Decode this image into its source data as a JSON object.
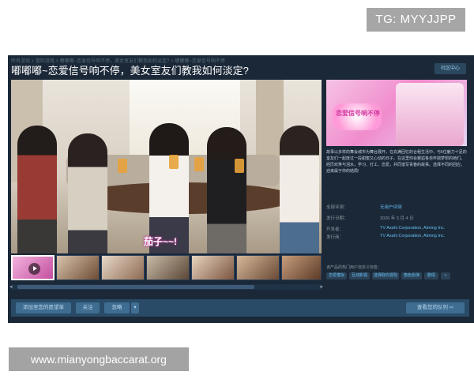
{
  "overlay": {
    "tg_badge": "TG: MYYJJPP",
    "website_watermark": "www.mianyongbaccarat.org"
  },
  "store_page": {
    "breadcrumb": "所有游戏 > 冒险游戏 > 嘟嘟嘟~恋爱信号响不停，美女室友们教我如何淡定? > 嘟嘟嘟~恋爱信号响不停",
    "title": "嘟嘟嘟~恋爱信号响不停，美女室友们教我如何淡定?",
    "community_button": "社区中心",
    "media": {
      "main_caption": "茄子~~!",
      "thumbnails": [
        {
          "type": "video",
          "active": true
        },
        {
          "type": "screenshot",
          "active": false
        },
        {
          "type": "screenshot",
          "active": false
        },
        {
          "type": "screenshot",
          "active": false
        },
        {
          "type": "screenshot",
          "active": false
        },
        {
          "type": "screenshot",
          "active": false
        },
        {
          "type": "screenshot",
          "active": false
        }
      ],
      "scroll_left": "◂",
      "scroll_right": "▸"
    },
    "capsule": {
      "logo_text": "恋爱信号响不停"
    },
    "description": "故事以多样的舞会城市为舞台展开，在充满回忆的合租生活中，与5位魅力十足的室友们一起度过一段甜蜜又心动的日子。在这里你会邂逅各自怀揣梦想的她们，经历欢笑与泪水，学习、打工、恋爱，共同谱写青春的故事。选择不同的回应，迎来属于你的结局!",
    "meta": [
      {
        "label": "全部评测：",
        "value": "无用户评测"
      },
      {
        "label": "发行日期：",
        "value": "2026 年 3 月 4 日"
      },
      {
        "label": "开发者：",
        "value": "TV Asahi Corporation, Aiming Inc."
      },
      {
        "label": "发行商：",
        "value": "TV Asahi Corporation, Aiming Inc."
      }
    ],
    "tags_label": "该产品的热门用户自定义标签：",
    "tags": [
      "恋爱模拟",
      "互动影视",
      "选择取向冒险",
      "角色扮演",
      "剧情",
      "+"
    ],
    "actions": {
      "wishlist": "添加至您的愿望单",
      "follow": "关注",
      "ignore": "忽略",
      "ignore_caret": "▾",
      "view_queue": "查看您的队列  ⇨"
    }
  }
}
